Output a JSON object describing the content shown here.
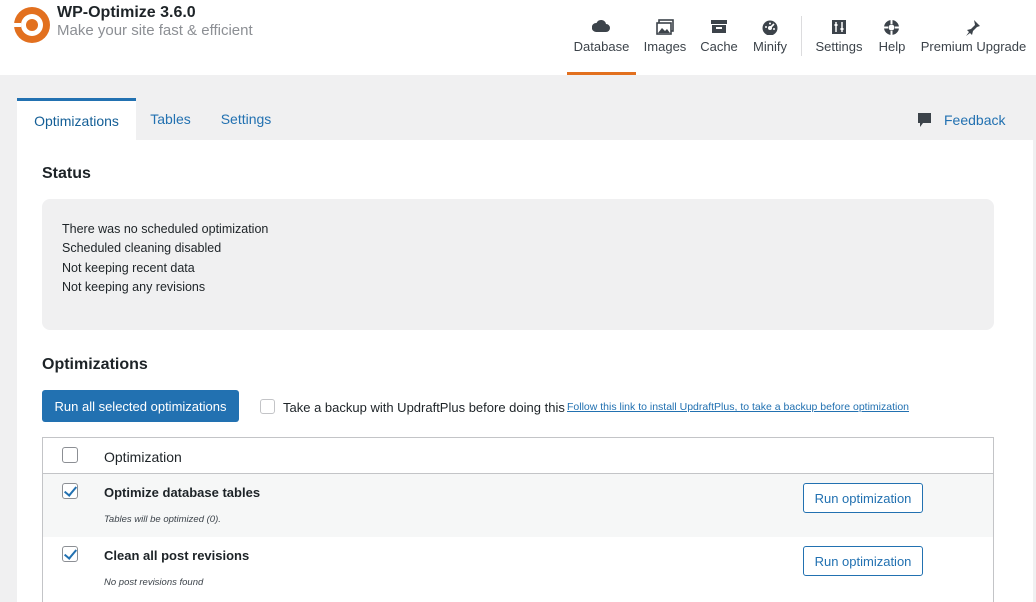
{
  "brand": {
    "title": "WP-Optimize 3.6.0",
    "subtitle": "Make your site fast & efficient"
  },
  "nav": [
    {
      "label": "Database",
      "icon": "database-icon"
    },
    {
      "label": "Images",
      "icon": "images-icon"
    },
    {
      "label": "Cache",
      "icon": "cache-icon"
    },
    {
      "label": "Minify",
      "icon": "minify-icon"
    },
    {
      "label": "Settings",
      "icon": "settings-icon"
    },
    {
      "label": "Help",
      "icon": "help-icon"
    },
    {
      "label": "Premium Upgrade",
      "icon": "premium-icon"
    }
  ],
  "tabs": [
    {
      "label": "Optimizations"
    },
    {
      "label": "Tables"
    },
    {
      "label": "Settings"
    }
  ],
  "feedback": {
    "label": "Feedback"
  },
  "status": {
    "heading": "Status",
    "lines": [
      "There was no scheduled optimization",
      "Scheduled cleaning disabled",
      "Not keeping recent data",
      "Not keeping any revisions"
    ]
  },
  "optimizations": {
    "heading": "Optimizations",
    "run_all_label": "Run all selected optimizations",
    "backup_text": "Take a backup with UpdraftPlus before doing this",
    "backup_link": "Follow this link to install UpdraftPlus, to take a backup before optimization",
    "table_header": "Optimization",
    "rows": [
      {
        "title": "Optimize database tables",
        "sub": "Tables will be optimized (0).",
        "button": "Run optimization"
      },
      {
        "title": "Clean all post revisions",
        "sub": "No post revisions found",
        "button": "Run optimization"
      }
    ]
  },
  "colors": {
    "accent": "#2271b1",
    "active_underline": "#e2701f",
    "logo": "#e2701f"
  }
}
